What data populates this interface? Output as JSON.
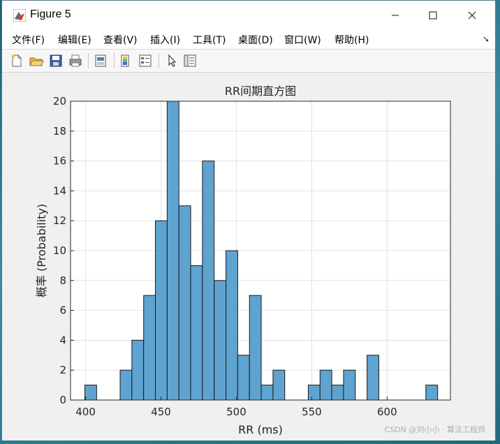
{
  "window": {
    "title": "Figure 5"
  },
  "menubar": {
    "items": [
      "文件(F)",
      "编辑(E)",
      "查看(V)",
      "插入(I)",
      "工具(T)",
      "桌面(D)",
      "窗口(W)",
      "帮助(H)"
    ]
  },
  "toolbar": {
    "icons": [
      "new-figure-icon",
      "open-file-icon",
      "save-icon",
      "print-icon",
      "print-preview-icon",
      "colorbar-icon",
      "legend-icon",
      "select-arrow-icon",
      "property-inspector-icon"
    ]
  },
  "chart_data": {
    "type": "bar",
    "title": "RR间期直方图",
    "xlabel": "RR (ms)",
    "ylabel": "概率 (Probability)",
    "xlim": [
      390,
      642
    ],
    "ylim": [
      0,
      20
    ],
    "xticks": [
      400,
      450,
      500,
      550,
      600
    ],
    "yticks": [
      0,
      2,
      4,
      6,
      8,
      10,
      12,
      14,
      16,
      18,
      20
    ],
    "grid": true,
    "bar_color": "#5fa3d0",
    "bins": [
      {
        "x0": 399.5,
        "x1": 407.3,
        "value": 1
      },
      {
        "x0": 422.9,
        "x1": 430.7,
        "value": 2
      },
      {
        "x0": 430.7,
        "x1": 438.5,
        "value": 4
      },
      {
        "x0": 438.5,
        "x1": 446.3,
        "value": 7
      },
      {
        "x0": 446.3,
        "x1": 454.1,
        "value": 12
      },
      {
        "x0": 454.1,
        "x1": 461.9,
        "value": 20
      },
      {
        "x0": 461.9,
        "x1": 469.7,
        "value": 13
      },
      {
        "x0": 469.7,
        "x1": 477.5,
        "value": 9
      },
      {
        "x0": 477.5,
        "x1": 485.3,
        "value": 16
      },
      {
        "x0": 485.3,
        "x1": 493.1,
        "value": 8
      },
      {
        "x0": 493.1,
        "x1": 500.9,
        "value": 10
      },
      {
        "x0": 500.9,
        "x1": 508.7,
        "value": 3
      },
      {
        "x0": 508.7,
        "x1": 516.5,
        "value": 7
      },
      {
        "x0": 516.5,
        "x1": 524.3,
        "value": 1
      },
      {
        "x0": 524.3,
        "x1": 532.1,
        "value": 2
      },
      {
        "x0": 547.7,
        "x1": 555.5,
        "value": 1
      },
      {
        "x0": 555.5,
        "x1": 563.3,
        "value": 2
      },
      {
        "x0": 563.3,
        "x1": 571.1,
        "value": 1
      },
      {
        "x0": 571.1,
        "x1": 578.9,
        "value": 2
      },
      {
        "x0": 586.7,
        "x1": 594.5,
        "value": 3
      },
      {
        "x0": 625.7,
        "x1": 633.5,
        "value": 1
      }
    ]
  },
  "watermark": "CSDN @刘小小 · 算法工程师"
}
